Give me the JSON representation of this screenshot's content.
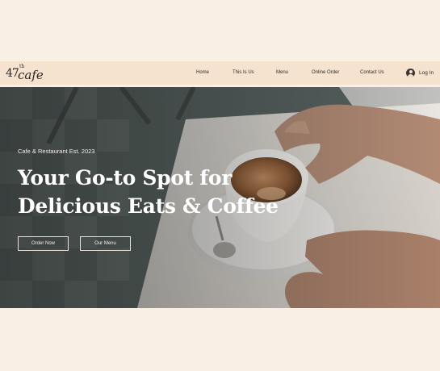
{
  "logo": {
    "number": "47",
    "superscript": "th",
    "word": "cafe"
  },
  "nav": {
    "links": [
      "Home",
      "This Is Us",
      "Menu",
      "Online Order",
      "Contact Us"
    ],
    "login": "Log In"
  },
  "hero": {
    "tagline": "Cafe & Restaurant Est. 2023",
    "headline_line1": "Your Go-to Spot for",
    "headline_line2": "Delicious Eats & Coffee",
    "primary_button": "Order Now",
    "secondary_button": "Our Menu"
  },
  "colors": {
    "page_background": "#f9efe4",
    "navbar_background": "#f6e3cf",
    "hero_text": "#ffffff"
  },
  "icons": {
    "login": "user-avatar-icon"
  }
}
